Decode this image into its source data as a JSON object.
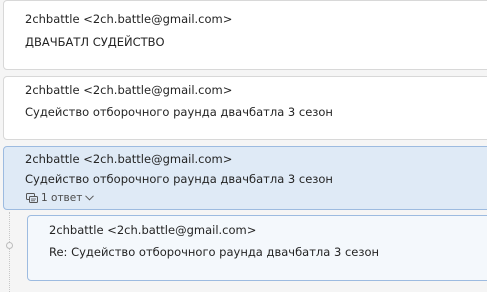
{
  "messages": [
    {
      "sender": "2chbattle <2ch.battle@gmail.com>",
      "subject": "ДВАЧБАТЛ СУДЕЙСТВО"
    },
    {
      "sender": "2chbattle <2ch.battle@gmail.com>",
      "subject": "Судейство отборочного раунда двачбатла 3 сезон"
    },
    {
      "sender": "2chbattle <2ch.battle@gmail.com>",
      "subject": "Судейство отборочного раунда двачбатла 3 сезон",
      "thread_count_label": "1 ответ",
      "thread_icon": "conversation-icon",
      "expand_icon": "chevron-down-icon",
      "selected": true
    }
  ],
  "reply": {
    "sender": "2chbattle <2ch.battle@gmail.com>",
    "subject": "Re: Судейство отборочного раунда двачбатла 3 сезон"
  },
  "colors": {
    "selected_bg": "#dfeaf6",
    "selected_border": "#9dbbe0",
    "reply_bg": "#f4f8fc"
  }
}
